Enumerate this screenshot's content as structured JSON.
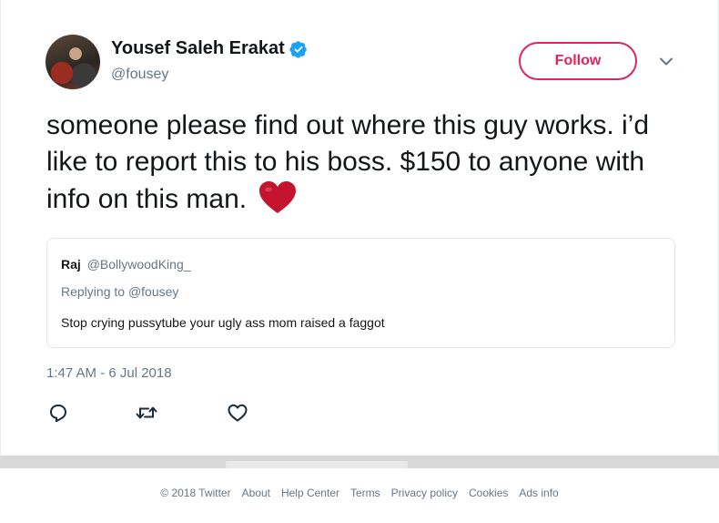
{
  "author": {
    "name": "Yousef Saleh Erakat",
    "handle": "@fousey",
    "verified_icon": "verified-badge-icon",
    "verified_color": "#1da1f2"
  },
  "follow_button": {
    "label": "Follow",
    "color": "#e0245e"
  },
  "tweet": {
    "text": "someone please find out where this guy works. i’d like to report this to his boss. $150 to anyone with info on this man.",
    "emoji": "heart-icon",
    "emoji_color": "#c4132f",
    "timestamp": "1:47 AM - 6 Jul 2018"
  },
  "quoted_tweet": {
    "name": "Raj",
    "handle": "@BollywoodKing_",
    "replying_prefix": "Replying to",
    "replying_to": "@fousey",
    "text": "Stop crying pussytube your ugly ass mom raised a faggot"
  },
  "actions": [
    {
      "name": "reply",
      "icon": "reply-icon"
    },
    {
      "name": "retweet",
      "icon": "retweet-icon"
    },
    {
      "name": "like",
      "icon": "like-icon"
    }
  ],
  "footer": {
    "copyright": "© 2018 Twitter",
    "links": [
      "About",
      "Help Center",
      "Terms",
      "Privacy policy",
      "Cookies",
      "Ads info"
    ]
  }
}
